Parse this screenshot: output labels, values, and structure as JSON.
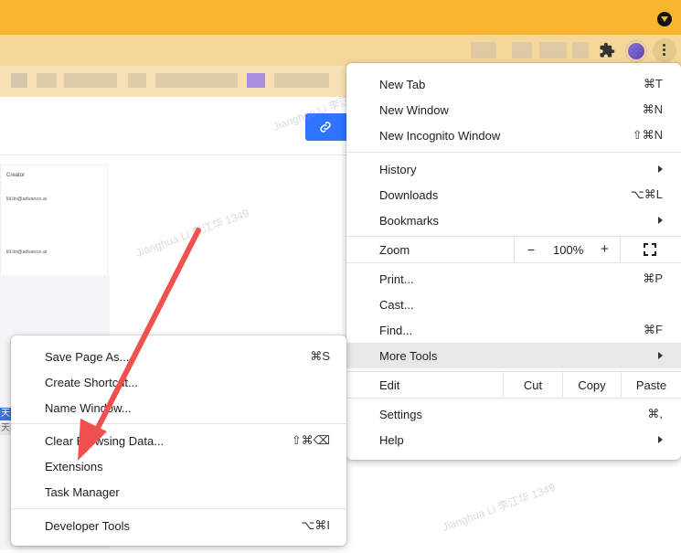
{
  "main_menu": {
    "items": [
      {
        "label": "New Tab",
        "shortcut": "⌘T"
      },
      {
        "label": "New Window",
        "shortcut": "⌘N"
      },
      {
        "label": "New Incognito Window",
        "shortcut": "⇧⌘N"
      },
      {
        "label": "History",
        "shortcut": ""
      },
      {
        "label": "Downloads",
        "shortcut": "⌥⌘L"
      },
      {
        "label": "Bookmarks",
        "shortcut": ""
      },
      {
        "label": "Print...",
        "shortcut": "⌘P"
      },
      {
        "label": "Cast...",
        "shortcut": ""
      },
      {
        "label": "Find...",
        "shortcut": "⌘F"
      },
      {
        "label": "More Tools",
        "shortcut": ""
      },
      {
        "label": "Settings",
        "shortcut": "⌘,"
      },
      {
        "label": "Help",
        "shortcut": ""
      }
    ],
    "zoom": {
      "label": "Zoom",
      "minus": "−",
      "value": "100%",
      "plus": "+"
    },
    "edit": {
      "label": "Edit",
      "cut": "Cut",
      "copy": "Copy",
      "paste": "Paste"
    }
  },
  "more_tools_menu": {
    "items": [
      {
        "label": "Save Page As...",
        "shortcut": "⌘S"
      },
      {
        "label": "Create Shortcut...",
        "shortcut": ""
      },
      {
        "label": "Name Window...",
        "shortcut": ""
      },
      {
        "label": "Clear Browsing Data...",
        "shortcut": "⇧⌘⌫"
      },
      {
        "label": "Extensions",
        "shortcut": ""
      },
      {
        "label": "Task Manager",
        "shortcut": ""
      },
      {
        "label": "Developer Tools",
        "shortcut": "⌥⌘I"
      }
    ]
  },
  "page": {
    "table_header": "Creator",
    "rows": [
      "lili.lin@advance.ai",
      "lili.lin@advance.ai"
    ],
    "watermark": "Jianghua Li 李江华 1349",
    "left_chips": [
      "天",
      "天"
    ]
  },
  "colors": {
    "titlebar": "#f9b52d",
    "accent_blue": "#2f74ff",
    "arrow_red": "#f0514f"
  }
}
